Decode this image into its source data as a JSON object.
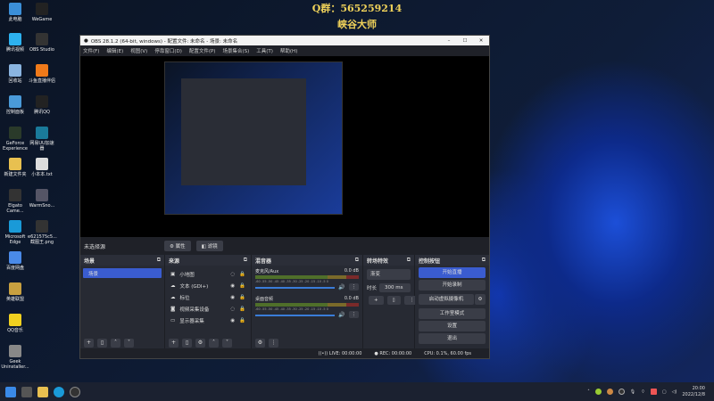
{
  "overlay": {
    "qq_group": "Q群：565259214",
    "name": "峡谷大师"
  },
  "desktop_icons": [
    {
      "label": "此电脑",
      "color": "#3b8fd8"
    },
    {
      "label": "WeGame",
      "color": "#222"
    },
    {
      "label": "腾讯视频",
      "color": "#2db2f0"
    },
    {
      "label": "OBS Studio",
      "color": "#333"
    },
    {
      "label": "回收站",
      "color": "#8ab4e0"
    },
    {
      "label": "斗鱼直播伴侣",
      "color": "#f07a1a"
    },
    {
      "label": "控制面板",
      "color": "#4a9ad8"
    },
    {
      "label": "腾讯QQ",
      "color": "#222"
    },
    {
      "label": "GeForce Experience",
      "color": "#2a3a2a"
    },
    {
      "label": "网易UU加速器",
      "color": "#1a7a9a"
    },
    {
      "label": "新建文件夹",
      "color": "#e8c050"
    },
    {
      "label": "小本本.txt",
      "color": "#ddd"
    },
    {
      "label": "Elgato Came...",
      "color": "#333"
    },
    {
      "label": "WarmSno...",
      "color": "#556"
    },
    {
      "label": "Microsoft Edge",
      "color": "#1a9ad8"
    },
    {
      "label": "e621575c5...截图王.png",
      "color": "#333"
    },
    {
      "label": "百度网盘",
      "color": "#4a8ae8"
    },
    {
      "label": "英雄联盟",
      "color": "#c8a040"
    },
    {
      "label": "QQ音乐",
      "color": "#f0d020"
    },
    {
      "label": "Geek Uninstaller...",
      "color": "#888"
    }
  ],
  "obs": {
    "title": "OBS 28.1.2 (64-bit, windows) - 配置文件: 未命名 - 场景: 未命名",
    "window_controls": [
      "–",
      "☐",
      "✕"
    ],
    "menu": [
      "文件(F)",
      "编辑(E)",
      "视图(V)",
      "停靠窗口(D)",
      "配置文件(P)",
      "场景集合(S)",
      "工具(T)",
      "帮助(H)"
    ],
    "no_source": "未选择源",
    "properties": "⚙ 属性",
    "filters": "◧ 滤镜",
    "scenes": {
      "title": "场景",
      "items": [
        "场景"
      ]
    },
    "sources": {
      "title": "来源",
      "items": [
        {
          "icon": "▣",
          "name": "小地图",
          "visible": "◌"
        },
        {
          "icon": "☁",
          "name": "文本 (GDI+)",
          "visible": "◉"
        },
        {
          "icon": "☁",
          "name": "标位",
          "visible": "◉"
        },
        {
          "icon": "◙",
          "name": "视频采集设备",
          "visible": "◌"
        },
        {
          "icon": "▭",
          "name": "显示器采集",
          "visible": "◉"
        }
      ]
    },
    "mixer": {
      "title": "混音器",
      "channels": [
        {
          "name": "麦克风/Aux",
          "db": "0.0 dB"
        },
        {
          "name": "桌面音频",
          "db": "0.0 dB"
        }
      ],
      "ticks": "-60 -55 -50 -45 -40 -35 -30 -25 -20 -15 -10 -5 0"
    },
    "transitions": {
      "title": "转场特效",
      "type": "渐变",
      "duration_label": "时长",
      "duration": "300 ms"
    },
    "controls": {
      "title": "控制按钮",
      "buttons": [
        "开始直播",
        "开始录制",
        "启动虚拟摄像机",
        "工作室模式",
        "设置",
        "退出"
      ]
    },
    "status": {
      "live": "((•)) LIVE: 00:00:00",
      "rec": "● REC: 00:00:00",
      "cpu": "CPU: 0.1%, 60.00 fps"
    }
  },
  "taskbar": {
    "time": "20:00",
    "date": "2022/12/8"
  },
  "colors": {
    "accent": "#3a5ccf",
    "overlay": "#f0d25a"
  }
}
